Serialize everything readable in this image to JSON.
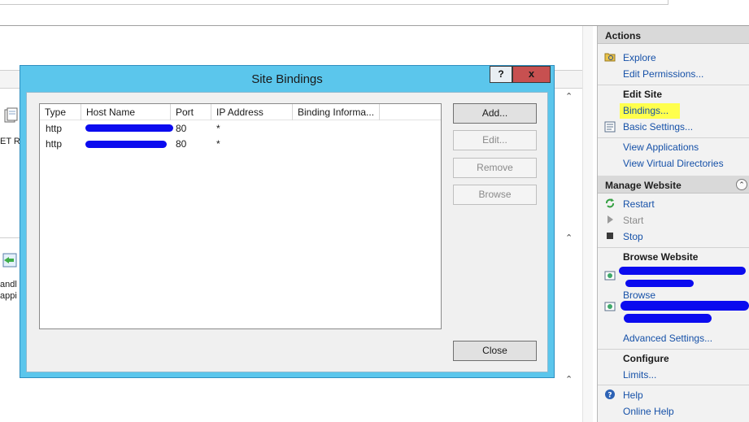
{
  "background": {
    "feature_labels": [
      "ET R",
      "andl",
      "appi"
    ]
  },
  "actions": {
    "header": "Actions",
    "explore": "Explore",
    "edit_permissions": "Edit Permissions...",
    "edit_site_title": "Edit Site",
    "bindings": "Bindings...",
    "basic_settings": "Basic Settings...",
    "view_applications": "View Applications",
    "view_virtual_directories": "View Virtual Directories",
    "manage_website_header": "Manage Website",
    "restart": "Restart",
    "start": "Start",
    "stop": "Stop",
    "browse_website_title": "Browse Website",
    "browse_2": "Browse",
    "advanced_settings": "Advanced Settings...",
    "configure_title": "Configure",
    "limits": "Limits...",
    "help": "Help",
    "online_help": "Online Help"
  },
  "dialog": {
    "title": "Site Bindings",
    "help_button": "?",
    "close_button": "x",
    "columns": [
      "Type",
      "Host Name",
      "Port",
      "IP Address",
      "Binding Informa..."
    ],
    "rows": [
      {
        "type": "http",
        "host": "",
        "port": "80",
        "ip": "*",
        "info": ""
      },
      {
        "type": "http",
        "host": "",
        "port": "80",
        "ip": "*",
        "info": ""
      }
    ],
    "buttons": {
      "add": "Add...",
      "edit": "Edit...",
      "remove": "Remove",
      "browse": "Browse",
      "close": "Close"
    }
  },
  "colors": {
    "dialog_frame": "#5bc6ec",
    "close_button": "#c75050",
    "link": "#1651a8",
    "highlight": "#ffff4d",
    "redaction": "#0b0bef"
  }
}
